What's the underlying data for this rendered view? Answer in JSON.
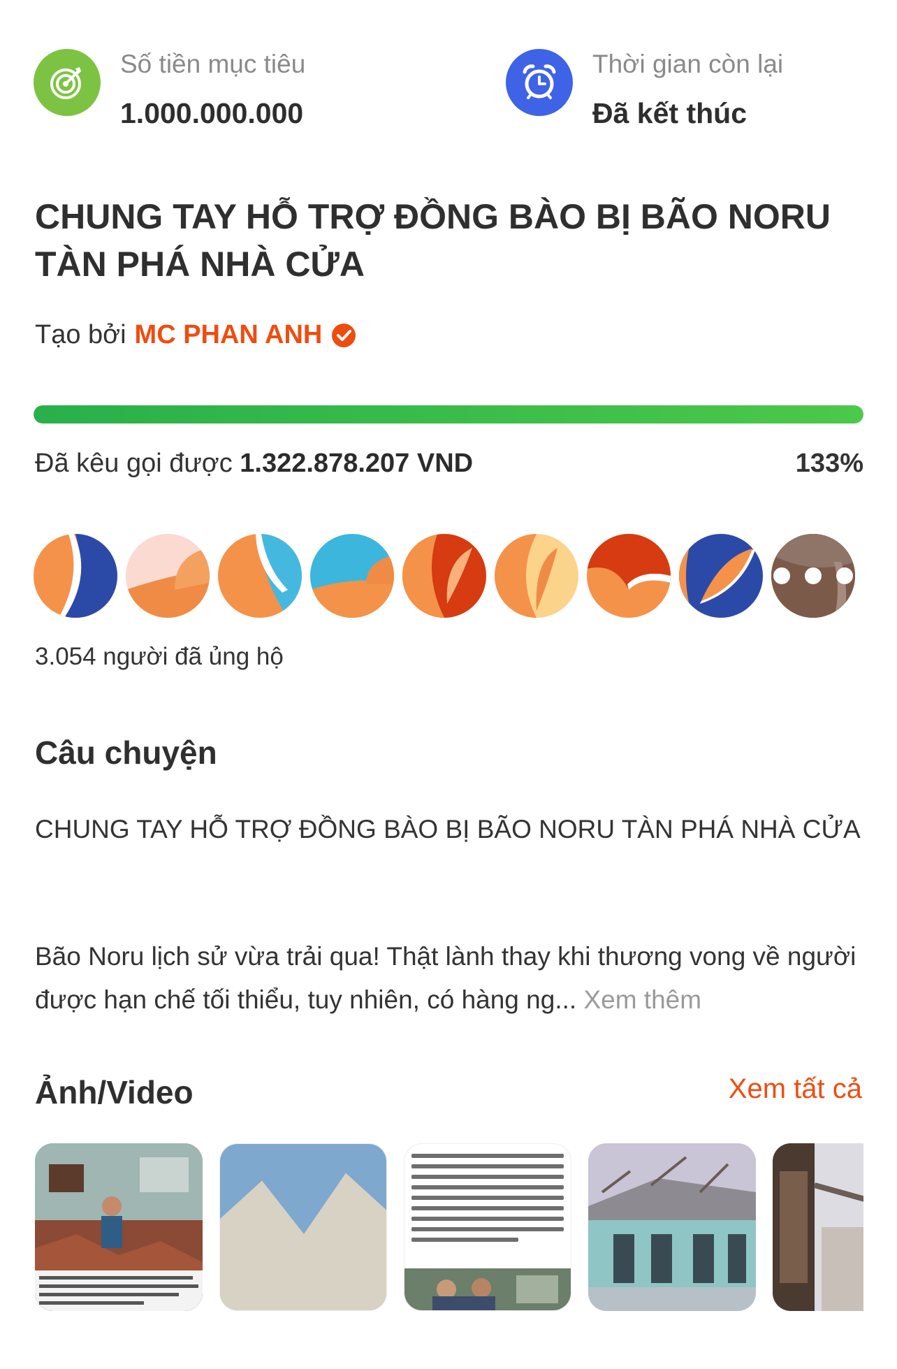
{
  "stats": {
    "target": {
      "label": "Số tiền mục tiêu",
      "value": "1.000.000.000",
      "color": "#7dc343",
      "icon": "target-icon"
    },
    "time": {
      "label": "Thời gian còn lại",
      "value": "Đã kết thúc",
      "color": "#3f63e6",
      "icon": "alarm-clock-icon"
    }
  },
  "campaign": {
    "title": "CHUNG TAY HỖ TRỢ ĐỒNG BÀO BỊ BÃO NORU TÀN PHÁ NHÀ CỬA",
    "created_by_label": "Tạo bởi",
    "creator_name": "MC PHAN ANH",
    "creator_verified_icon": "verified-check-icon",
    "accent_color": "#ee4d10"
  },
  "progress": {
    "fraction": 1.0,
    "raised_label": "Đã kêu gọi được",
    "raised_amount": "1.322.878.207 VND",
    "percent_text": "133%"
  },
  "supporters": {
    "count_text": "3.054 người đã ủng hộ",
    "more_icon": "more-dots-icon"
  },
  "story": {
    "heading": "Câu chuyện",
    "title_text": "CHUNG TAY HỖ TRỢ ĐỒNG BÀO BỊ BÃO NORU TÀN PHÁ NHÀ CỬA",
    "excerpt": "Bão Noru lịch sử vừa trải qua! Thật lành thay khi thương vong về người được hạn chế tối thiểu, tuy nhiên, có hàng ng...",
    "more_label": "Xem thêm"
  },
  "media": {
    "heading": "Ảnh/Video",
    "see_all_label": "Xem tất cả"
  }
}
